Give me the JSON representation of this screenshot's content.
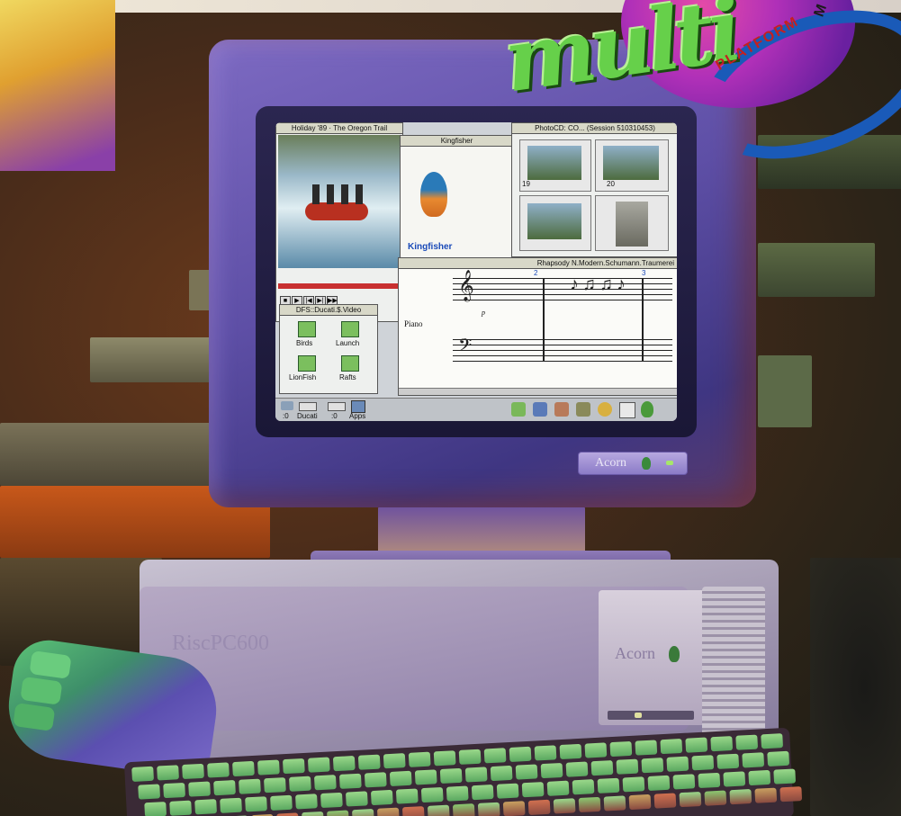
{
  "logo": {
    "word": "multi",
    "ribbon": "PLATFORM",
    "ribbon_end": "M"
  },
  "monitor": {
    "brand": "Acorn"
  },
  "computer": {
    "model": "RiscPC600",
    "brand": "Acorn"
  },
  "screen": {
    "video_window_title": "Holiday '89 · The Oregon Trail",
    "kingfisher_window_title": "Kingfisher",
    "kingfisher_caption": "Kingfisher",
    "photocd_window_title": "PhotoCD: CO... (Session 510310453)",
    "thumb_numbers": [
      "19",
      "20"
    ],
    "score_window_title": "Rhapsody N.Modern.Schumann.Traumerei",
    "score_measure_numbers": [
      "2",
      "3"
    ],
    "score_instrument": "Piano",
    "score_dynamic": "p",
    "filer_window_title": "DFS::Ducati.$.Video",
    "filer_items": [
      "Birds",
      "Launch",
      "LionFish",
      "Rafts"
    ],
    "iconbar_items": [
      ":0",
      "Ducati",
      ":0",
      "Apps"
    ]
  },
  "colors": {
    "logo_green": "#66d04a",
    "logo_ball": "#b030b8",
    "ring_blue": "#1a5ab8",
    "monitor_purple": "#5e4fa6",
    "keyboard_key_green": "#9ad88a"
  }
}
